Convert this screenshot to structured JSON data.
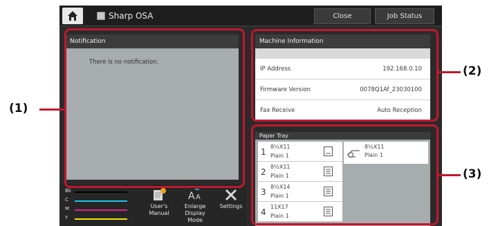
{
  "topbar": {
    "app_title": "Sharp OSA",
    "close_label": "Close",
    "job_status_label": "Job Status"
  },
  "notification": {
    "header": "Notification",
    "message": "There is no notification."
  },
  "machine_info": {
    "header": "Machine Information",
    "rows": [
      {
        "label": "IP Address",
        "value": "192.168.0.10"
      },
      {
        "label": "Firmware Version",
        "value": "0078Q1Af_23030100"
      },
      {
        "label": "Fax Receive",
        "value": "Auto Reception"
      }
    ]
  },
  "paper_tray": {
    "header": "Paper Tray",
    "trays": [
      {
        "number": "1",
        "size": "8½X11",
        "type": "Plain 1"
      },
      {
        "number": "2",
        "size": "8½X11",
        "type": "Plain 1"
      },
      {
        "number": "3",
        "size": "8½X14",
        "type": "Plain 1"
      },
      {
        "number": "4",
        "size": "11X17",
        "type": "Plain 1"
      }
    ],
    "bypass": {
      "size": "8½X11",
      "type": "Plain 1"
    }
  },
  "toner": {
    "colors": [
      {
        "label": "Bk",
        "color": "#000000"
      },
      {
        "label": "C",
        "color": "#1ec8f0"
      },
      {
        "label": "M",
        "color": "#e0208c"
      },
      {
        "label": "Y",
        "color": "#f5e600"
      }
    ]
  },
  "bottom_buttons": {
    "manual_line1": "User's",
    "manual_line2": "Manual",
    "enlarge_line1": "Enlarge",
    "enlarge_line2": "Display Mode",
    "settings": "Settings"
  },
  "callouts": {
    "one": "(1)",
    "two": "(2)",
    "three": "(3)"
  },
  "accent_color": "#c0182d"
}
